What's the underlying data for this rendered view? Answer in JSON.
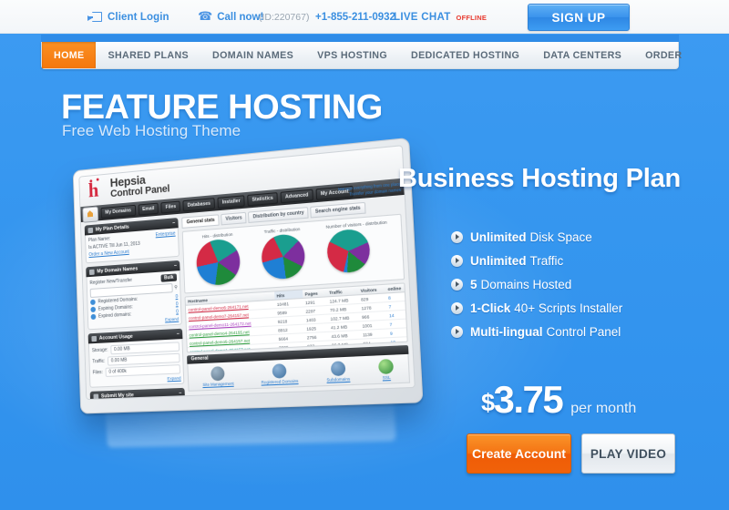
{
  "topbar": {
    "client_login": "Client Login",
    "call_now": "Call now!",
    "call_id": "(ID:220767)",
    "phone": "+1-855-211-0932",
    "live_chat": "LIVE CHAT",
    "live_chat_state": "OFFLINE",
    "signup": "SIGN UP",
    "icons": {
      "login": "login-arrow-icon",
      "phone": "phone-icon"
    }
  },
  "nav": {
    "items": [
      {
        "label": "HOME",
        "active": true
      },
      {
        "label": "SHARED PLANS",
        "active": false
      },
      {
        "label": "DOMAIN NAMES",
        "active": false
      },
      {
        "label": "VPS HOSTING",
        "active": false
      },
      {
        "label": "DEDICATED HOSTING",
        "active": false
      },
      {
        "label": "DATA CENTERS",
        "active": false
      },
      {
        "label": "ORDER",
        "active": false
      }
    ]
  },
  "hero": {
    "title": "FEATURE HOSTING",
    "subtitle": "Free Web Hosting Theme"
  },
  "plan": {
    "title": "Business Hosting Plan",
    "features": [
      {
        "strong": "Unlimited",
        "rest": "Disk Space"
      },
      {
        "strong": "Unlimited",
        "rest": "Traffic"
      },
      {
        "strong": "5",
        "rest": "Domains Hosted"
      },
      {
        "strong": "1-Click",
        "rest": "40+ Scripts Installer"
      },
      {
        "strong": "Multi-lingual",
        "rest": "Control Panel"
      }
    ],
    "price_currency": "$",
    "price_amount": "3.75",
    "price_period": "per month",
    "create_account": "Create Account",
    "play_video": "PLAY VIDEO"
  },
  "control_panel": {
    "brand_line1": "Hepsia",
    "brand_line2": "Control Panel",
    "top_tabs": [
      "My Domains",
      "Email",
      "Files",
      "Databases",
      "Installer",
      "Statistics",
      "Advanced",
      "My Account"
    ],
    "top_right_links": [
      "Manage everything from one place",
      "Transfer your domain names",
      "View tutorial - sign up"
    ],
    "panels": [
      {
        "title": "My Plan Details",
        "rows": [
          {
            "label": "Plan Name:",
            "value": "Enterprise"
          },
          {
            "label": "Is ACTIVE Till Jun 11, 2013",
            "value": ""
          },
          {
            "label": "Order a New Account",
            "value": ""
          }
        ]
      },
      {
        "title": "My Domain Names",
        "register_label": "Register New/Transfer",
        "register_button": "Bulk",
        "search_placeholder": "",
        "rows": [
          {
            "label": "Registered Domains:",
            "value": "0"
          },
          {
            "label": "Expiring Domains:",
            "value": "0"
          },
          {
            "label": "Expired domains:",
            "value": "0"
          }
        ],
        "expand": "Expand"
      },
      {
        "title": "Account Usage",
        "rows": [
          {
            "label": "Storage:",
            "value": "0.00 MB"
          },
          {
            "label": "Traffic:",
            "value": "0.00 MB"
          },
          {
            "label": "Files:",
            "value": "0 of 400k"
          }
        ],
        "expand": "Expand"
      },
      {
        "title": "Submit My site",
        "rows": []
      }
    ],
    "sub_tabs": [
      "General stats",
      "Visitors",
      "Distribution by country",
      "Search engine stats"
    ],
    "charts": [
      {
        "title": "Hits - distribution"
      },
      {
        "title": "Traffic - distribution"
      },
      {
        "title": "Number of visitors - distribution"
      }
    ],
    "table": {
      "headers": [
        "Hostname",
        "Hits",
        "Pages",
        "Traffic",
        "Visitors",
        "online"
      ],
      "rows": [
        [
          "control-panel-demo6-264171.net",
          "10481",
          "1291",
          "124.7 MB",
          "829",
          "8"
        ],
        [
          "control-panel-demo7-264157.net",
          "9589",
          "2297",
          "70.2 MB",
          "1278",
          "7"
        ],
        [
          "control-panel-demo11-264172.net",
          "9218",
          "1403",
          "102.7 MB",
          "966",
          "14"
        ],
        [
          "control-panel-demo4-264155.net",
          "8912",
          "1925",
          "41.2 MB",
          "1001",
          "7"
        ],
        [
          "control-panel-demo5-264157.net",
          "5664",
          "2756",
          "43.6 MB",
          "1139",
          "9"
        ],
        [
          "control-panel-demo1-264157.net",
          "3206",
          "973",
          "26.3 MB",
          "584",
          "10"
        ]
      ]
    },
    "general_title": "General",
    "quick_icons": [
      {
        "label": "Site Management",
        "icon": "gear-icon"
      },
      {
        "label": "Registered Domains",
        "icon": "globe-icon"
      },
      {
        "label": "Subdomains",
        "icon": "globe-icon"
      },
      {
        "label": "SSL",
        "icon": "lock-icon"
      }
    ]
  },
  "colors": {
    "page_blue": "#3596ef",
    "accent_orange": "#f4770d",
    "link_blue": "#3b8fe0",
    "offline_red": "#e8392e"
  }
}
